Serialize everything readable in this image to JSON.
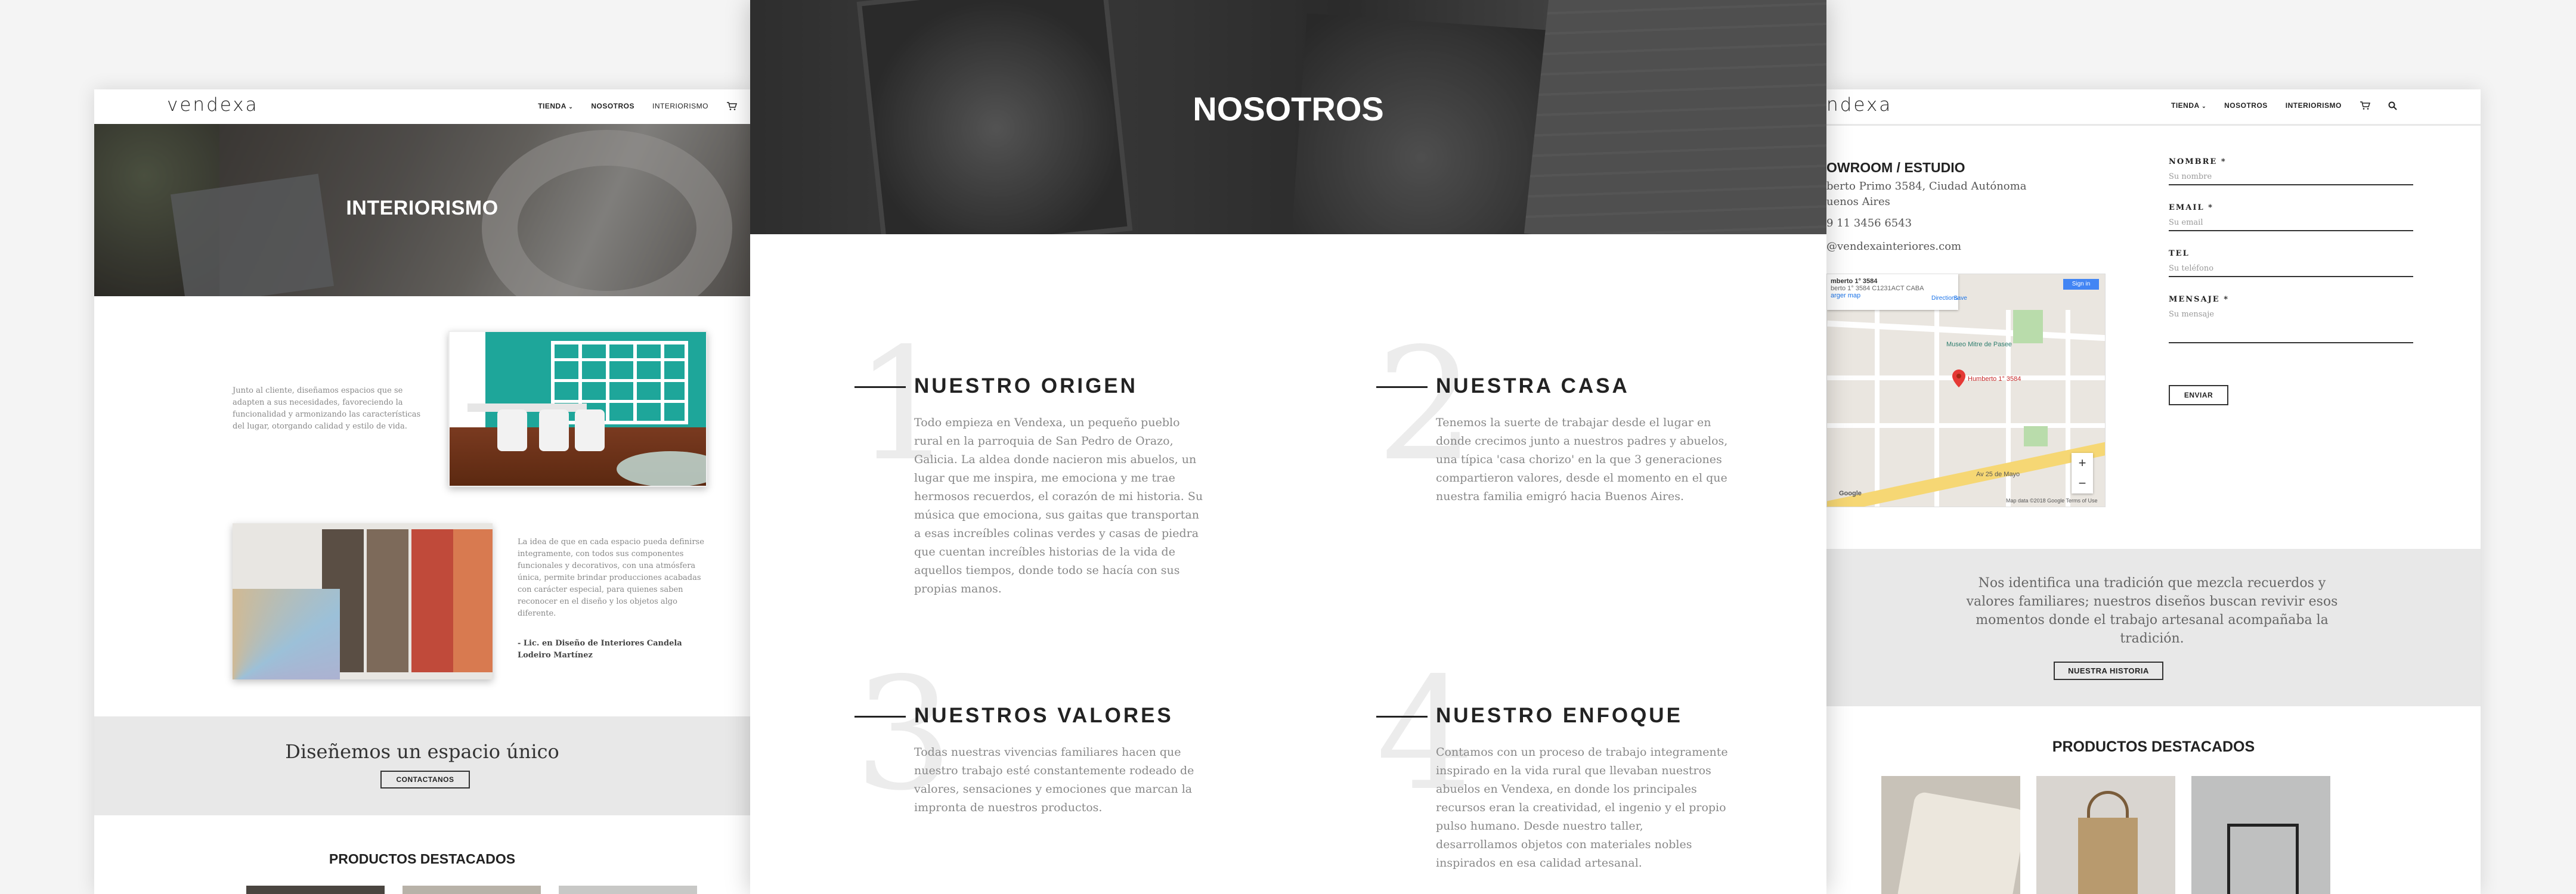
{
  "brand": {
    "logo": "vendexa",
    "right_logo": "ndexa"
  },
  "nav": {
    "tienda": "TIENDA",
    "nosotros": "NOSOTROS",
    "interiorismo": "INTERIORISMO"
  },
  "left": {
    "hero_title": "INTERIORISMO",
    "intro": "Junto al cliente, diseñamos espacios que se adapten a sus necesidades, favoreciendo la funcionalidad y armonizando las características del lugar, otorgando calidad y estilo de vida.",
    "quote": "La idea de que en cada espacio pueda definirse integramente, con todos sus componentes funcionales y decorativos, con una atmósfera única, permite brindar producciones acabadas con carácter especial, para quienes saben reconocer en el diseño y los objetos algo diferente.",
    "author": "- Lic. en Diseño de Interiores Candela Lodeiro Martínez",
    "band_title": "Diseñemos un espacio único",
    "band_button": "CONTACTANOS",
    "products_title": "PRODUCTOS DESTACADOS"
  },
  "middle": {
    "hero_title": "NOSOTROS",
    "blocks": [
      {
        "number": "1",
        "title": "NUESTRO ORIGEN",
        "text": "Todo empieza en Vendexa, un pequeño pueblo rural en la parroquia de San Pedro de Orazo, Galicia. La aldea donde nacieron mis abuelos, un lugar que me inspira, me emociona y me trae hermosos recuerdos, el corazón de mi historia. Su música que emociona, sus gaitas que transportan a esas increíbles colinas verdes y casas de piedra que cuentan increíbles historias de la vida de aquellos tiempos, donde todo se hacía con sus propias manos."
      },
      {
        "number": "2",
        "title": "NUESTRA CASA",
        "text": "Tenemos la suerte de trabajar desde el lugar en donde crecimos junto a nuestros padres y abuelos, una típica 'casa chorizo' en la que 3 generaciones compartieron valores, desde el momento en el que nuestra familia emigró hacia Buenos Aires."
      },
      {
        "number": "3",
        "title": "NUESTROS VALORES",
        "text": "Todas nuestras vivencias familiares hacen que nuestro trabajo esté constantemente rodeado de valores, sensaciones y emociones que marcan la impronta de nuestros productos."
      },
      {
        "number": "4",
        "title": "NUESTRO ENFOQUE",
        "text": "Contamos con un proceso de trabajo integramente inspirado en la vida rural que llevaban nuestros abuelos en Vendexa, en donde los principales recursos eran la creatividad, el ingenio y el propio pulso humano. Desde nuestro taller, desarrollamos objetos con materiales nobles inspirados en esa calidad artesanal."
      }
    ]
  },
  "right": {
    "showroom_title": "OWROOM / ESTUDIO",
    "address": "berto Primo 3584, Ciudad Autónoma uenos Aires",
    "phone": "9 11 3456 6543",
    "email": "@vendexainteriores.com",
    "map": {
      "info_title": "mberto 1° 3584",
      "info_addr": "berto 1° 3584 C1231ACT CABA",
      "larger_map": "arger map",
      "directions": "Directions",
      "save": "Save",
      "sign_in": "Sign in",
      "pin_label": "Humberto 1° 3584",
      "museum": "Museo Mitre de Pasee",
      "street": "Av 25 de Mayo",
      "google": "Google",
      "footer": "Map data ©2018 Google   Terms of Use",
      "zoom_in": "+",
      "zoom_out": "−"
    },
    "form": {
      "nombre_label": "NOMBRE *",
      "nombre_placeholder": "Su nombre",
      "email_label": "EMAIL *",
      "email_placeholder": "Su email",
      "tel_label": "TEL",
      "tel_placeholder": "Su teléfono",
      "mensaje_label": "MENSAJE *",
      "mensaje_placeholder": "Su mensaje",
      "submit": "ENVIAR"
    },
    "band_text": "Nos identifica una tradición que mezcla recuerdos y valores familiares; nuestros diseños buscan revivir esos momentos donde el trabajo artesanal acompañaba la tradición.",
    "band_button": "NUESTRA HISTORIA",
    "products_title": "PRODUCTOS DESTACADOS"
  },
  "icons": {
    "cart": "cart-icon",
    "search": "search-icon",
    "chevron": "chevron-down-icon",
    "pin": "map-pin-icon"
  }
}
